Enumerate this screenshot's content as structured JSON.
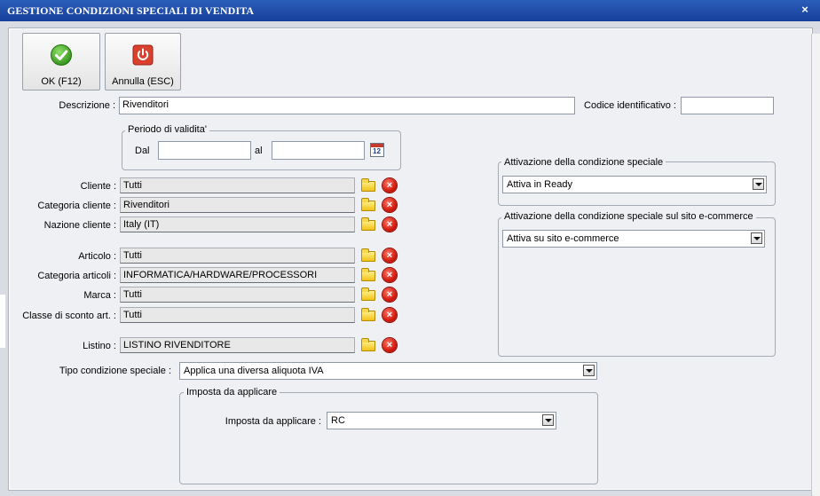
{
  "window": {
    "title": "GESTIONE CONDIZIONI SPECIALI DI VENDITA",
    "close_glyph": "×"
  },
  "toolbar": {
    "ok_label": "OK (F12)",
    "ok_icon": "check-icon",
    "cancel_label": "Annulla (ESC)",
    "cancel_icon": "power-icon"
  },
  "descrizione": {
    "label": "Descrizione :",
    "value": "Rivenditori"
  },
  "codice": {
    "label": "Codice identificativo :",
    "value": ""
  },
  "periodo": {
    "title": "Periodo di validita'",
    "dal_label": "Dal",
    "dal_value": "",
    "al_label": "al",
    "al_value": ""
  },
  "fields": {
    "cliente": {
      "label": "Cliente :",
      "value": "Tutti"
    },
    "categoria_cliente": {
      "label": "Categoria cliente :",
      "value": "Rivenditori"
    },
    "nazione_cliente": {
      "label": "Nazione cliente :",
      "value": "Italy (IT)"
    },
    "articolo": {
      "label": "Articolo :",
      "value": "Tutti"
    },
    "categoria_articoli": {
      "label": "Categoria articoli :",
      "value": "INFORMATICA/HARDWARE/PROCESSORI"
    },
    "marca": {
      "label": "Marca :",
      "value": "Tutti"
    },
    "classe_sconto": {
      "label": "Classe di sconto art. :",
      "value": "Tutti"
    },
    "listino": {
      "label": "Listino :",
      "value": "LISTINO RIVENDITORE"
    }
  },
  "tipo_condizione": {
    "label": "Tipo condizione speciale :",
    "value": "Applica una diversa aliquota IVA"
  },
  "imposta_group": {
    "title": "Imposta da applicare",
    "label": "Imposta da applicare :",
    "value": "RC"
  },
  "attivazione": {
    "title": "Attivazione della condizione speciale",
    "value": "Attiva in Ready"
  },
  "attivazione_ecommerce": {
    "title": "Attivazione della condizione speciale sul sito e-commerce",
    "value": "Attiva su sito e-commerce"
  },
  "colors": {
    "titlebar": "#1f4ea8",
    "ok_green": "#3aa51f",
    "cancel_red": "#d9412e",
    "remove_red": "#d21a0e",
    "folder_yellow": "#f2c316"
  }
}
